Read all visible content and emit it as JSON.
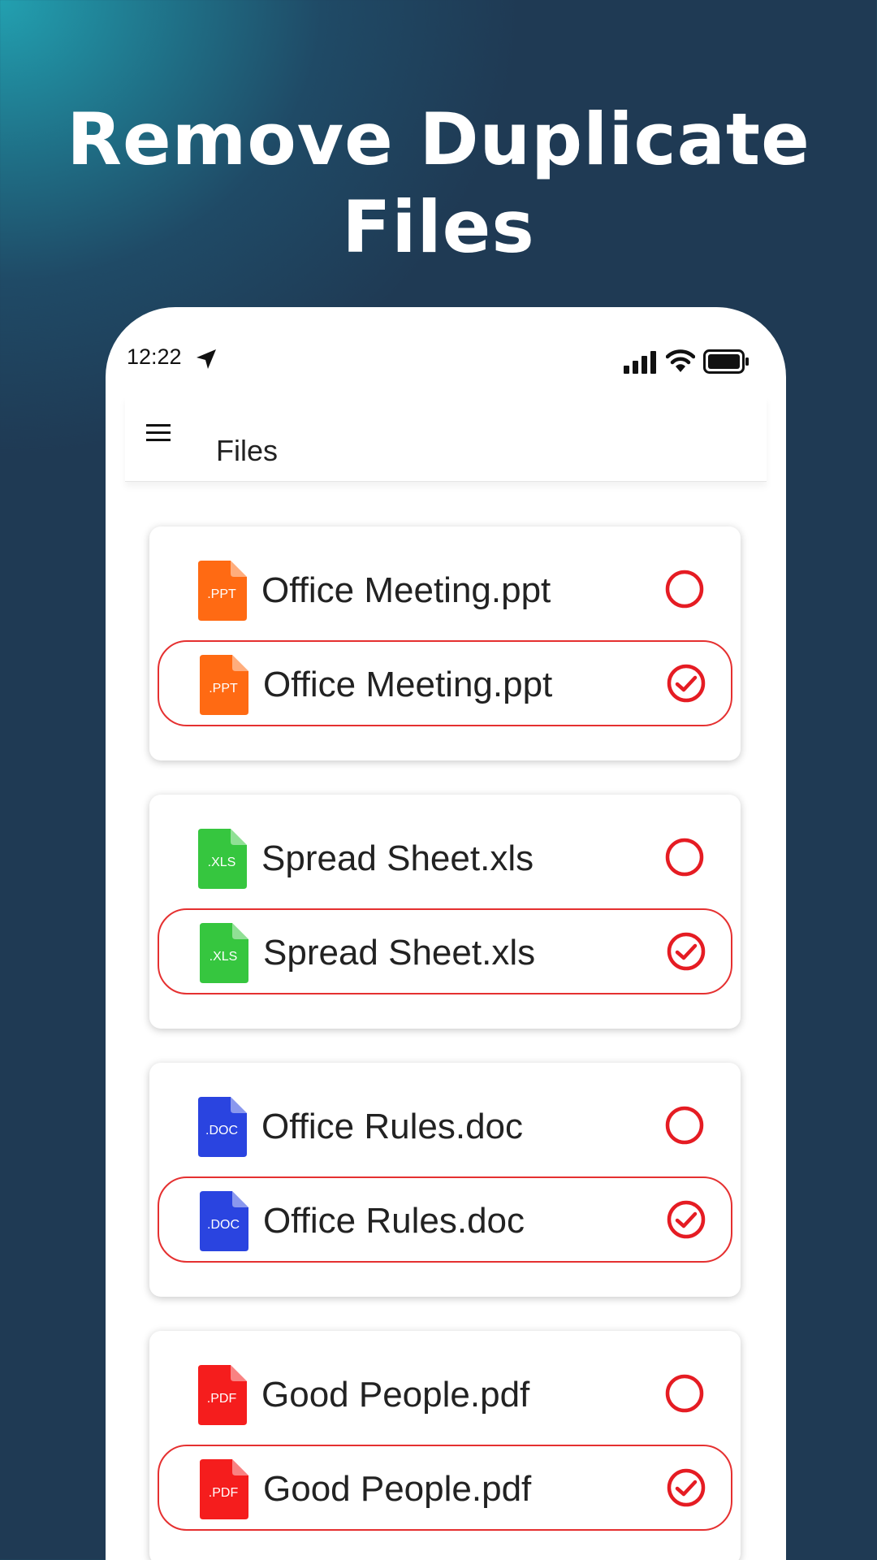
{
  "headline": {
    "line1": "Remove Duplicate",
    "line2": "Files"
  },
  "status_bar": {
    "time": "12:22",
    "icons": [
      "location-arrow-icon",
      "signal-icon",
      "wifi-icon",
      "battery-icon"
    ]
  },
  "app_bar": {
    "menu_icon": "hamburger-menu-icon",
    "title": "Files"
  },
  "files": [
    {
      "type_label": ".PPT",
      "color": "#ff6a13",
      "original": {
        "name": "Office Meeting.ppt",
        "selected": false
      },
      "duplicate": {
        "name": "Office Meeting.ppt",
        "selected": true
      }
    },
    {
      "type_label": ".XLS",
      "color": "#36c63f",
      "original": {
        "name": "Spread Sheet.xls",
        "selected": false
      },
      "duplicate": {
        "name": "Spread Sheet.xls",
        "selected": true
      }
    },
    {
      "type_label": ".DOC",
      "color": "#2a44e0",
      "original": {
        "name": "Office Rules.doc",
        "selected": false
      },
      "duplicate": {
        "name": "Office Rules.doc",
        "selected": true
      }
    },
    {
      "type_label": ".PDF",
      "color": "#f51d1d",
      "original": {
        "name": "Good People.pdf",
        "selected": false
      },
      "duplicate": {
        "name": "Good People.pdf",
        "selected": true
      }
    }
  ],
  "colors": {
    "accent_red": "#e51c23",
    "background": "#1f3a54",
    "gradient_highlight": "#22a0b0"
  }
}
